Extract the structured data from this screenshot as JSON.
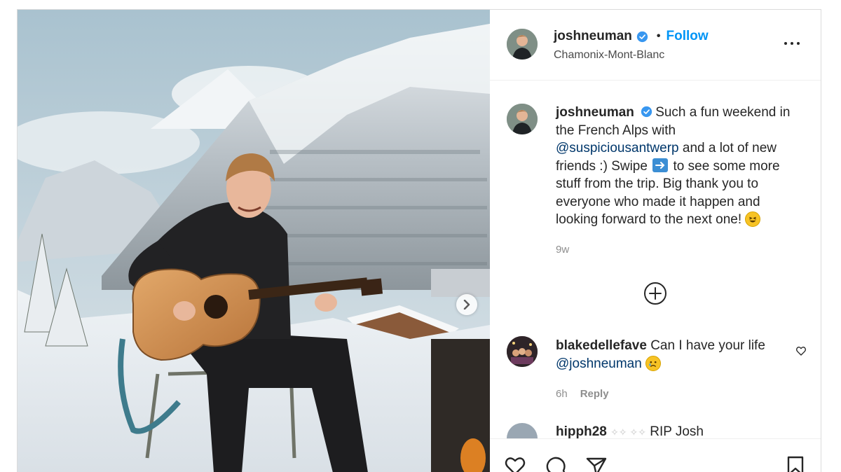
{
  "post": {
    "username": "joshneuman",
    "follow_label": "Follow",
    "separator": "•",
    "location": "Chamonix-Mont-Blanc"
  },
  "caption": {
    "username": "joshneuman",
    "text_1": "Such a fun weekend in the French Alps with ",
    "mention": "@suspiciousantwerp",
    "text_2": " and a lot of new friends :) Swipe ",
    "text_3": " to see some more stuff from the trip. Big thank you to everyone who made it happen and looking forward to the next one! ",
    "time": "9w"
  },
  "comments": [
    {
      "username": "blakedellefave",
      "text": " Can I have your life ",
      "mention": "@joshneuman",
      "time": "6h",
      "reply_label": "Reply"
    },
    {
      "username": "hipph28",
      "text": " RIP Josh"
    }
  ],
  "icons": {
    "verified": "verified-badge-icon",
    "more": "more-options-icon",
    "carousel": "chevron-right-icon",
    "load_more": "plus-circle-icon",
    "like": "heart-icon",
    "comment": "comment-icon",
    "share": "paper-plane-icon",
    "save": "bookmark-icon"
  },
  "colors": {
    "accent": "#0095f6",
    "mention": "#00376b",
    "verified": "#3897f0",
    "muted": "#8e8e8e"
  }
}
